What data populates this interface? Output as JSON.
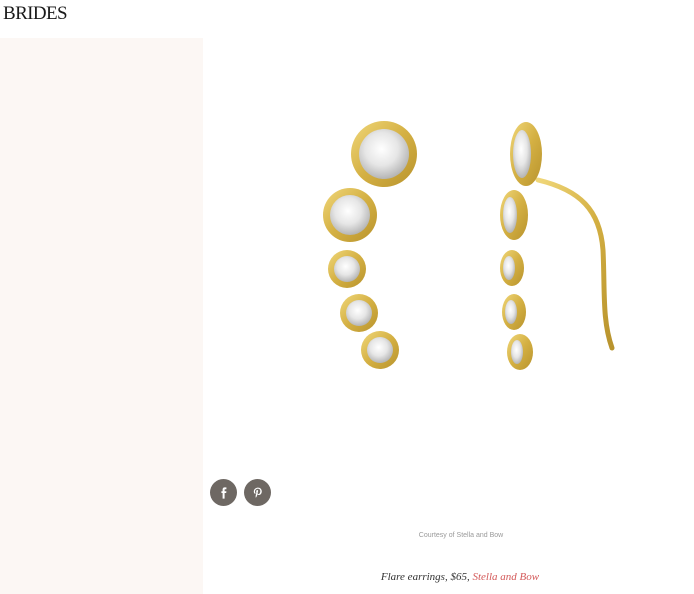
{
  "header": {
    "logo_text": "BRIDES"
  },
  "share": {
    "facebook_icon": "facebook-icon",
    "pinterest_icon": "pinterest-icon",
    "button_color": "#6e6863"
  },
  "image": {
    "credit": "Courtesy of Stella and Bow"
  },
  "caption": {
    "text": "Flare earrings, $65, ",
    "link_text": "Stella and Bow",
    "link_color": "#d45a5a"
  },
  "colors": {
    "sidebar_bg": "#fcf7f4",
    "gold": "#d8b84a"
  }
}
